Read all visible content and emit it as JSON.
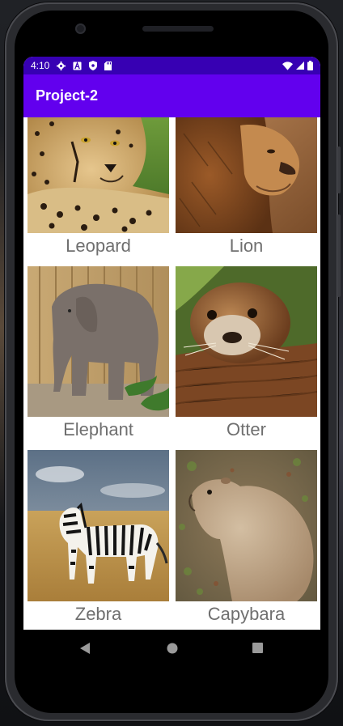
{
  "status_bar": {
    "time": "4:10",
    "left_icons": [
      "gear-icon",
      "a-icon",
      "shield-icon",
      "sd-card-icon"
    ],
    "right_icons": [
      "wifi-icon",
      "signal-icon",
      "battery-icon"
    ],
    "background": "#3700b3"
  },
  "app_bar": {
    "title": "Project-2",
    "background": "#6200ee"
  },
  "animals": [
    {
      "label": "Leopard",
      "image": "cheetah-photo"
    },
    {
      "label": "Lion",
      "image": "lion-photo"
    },
    {
      "label": "Elephant",
      "image": "elephant-photo"
    },
    {
      "label": "Otter",
      "image": "otter-photo"
    },
    {
      "label": "Zebra",
      "image": "zebra-photo"
    },
    {
      "label": "Capybara",
      "image": "capybara-photo"
    }
  ],
  "nav_bar": {
    "buttons": [
      "back-icon",
      "home-icon",
      "recents-icon"
    ]
  }
}
